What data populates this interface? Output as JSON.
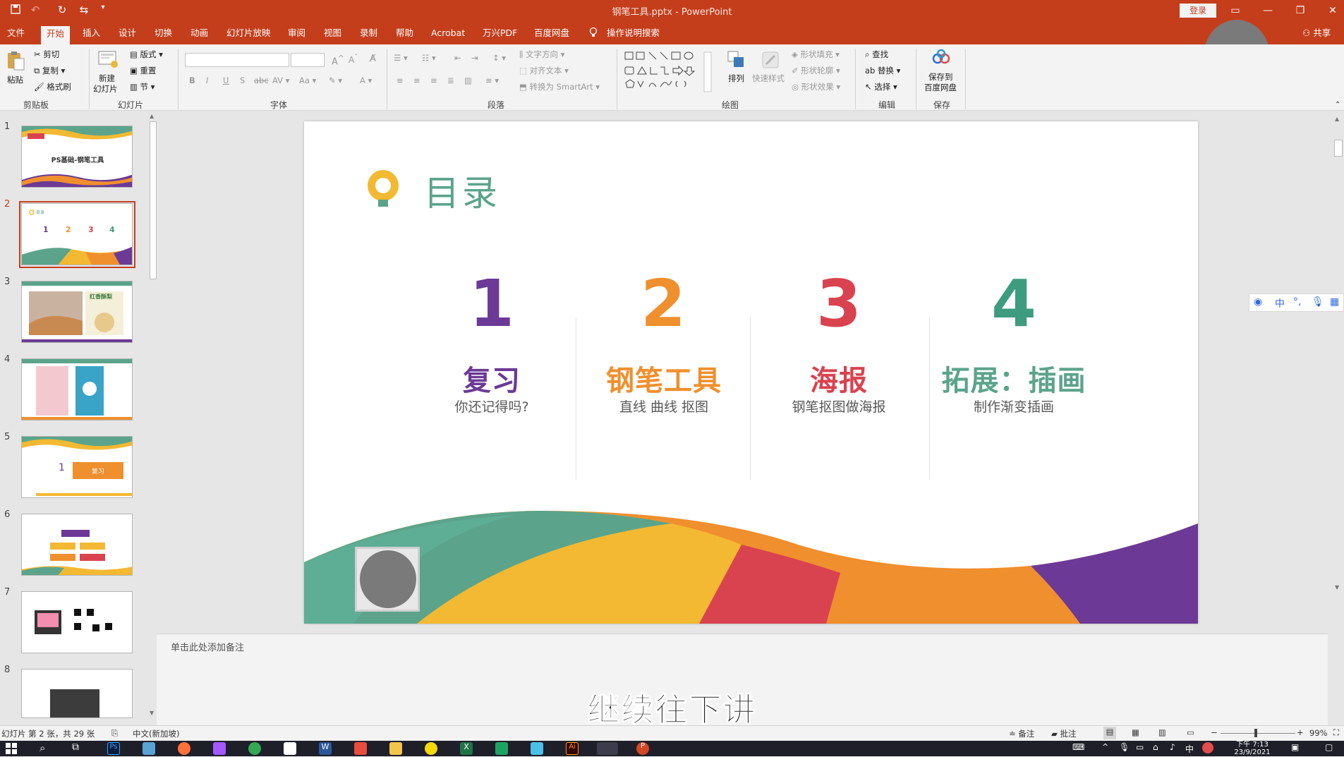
{
  "titlebar": {
    "title": "钢笔工具.pptx  -  PowerPoint",
    "login": "登录",
    "share": "共享",
    "tell_me": "操作说明搜索"
  },
  "tabs": [
    "文件",
    "开始",
    "插入",
    "设计",
    "切换",
    "动画",
    "幻灯片放映",
    "审阅",
    "视图",
    "录制",
    "帮助",
    "Acrobat",
    "万兴PDF",
    "百度网盘"
  ],
  "ribbon": {
    "clipboard": {
      "label": "剪贴板",
      "paste": "粘贴",
      "cut": "剪切",
      "copy": "复制",
      "format_painter": "格式刷"
    },
    "slides": {
      "label": "幻灯片",
      "new_slide_1": "新建",
      "new_slide_2": "幻灯片",
      "layout": "版式",
      "reset": "重置",
      "section": "节"
    },
    "font": {
      "label": "字体"
    },
    "paragraph": {
      "label": "段落",
      "text_direction": "文字方向",
      "align_text": "对齐文本",
      "smartart": "转换为 SmartArt"
    },
    "drawing": {
      "label": "绘图",
      "arrange": "排列",
      "quick_styles": "快速样式",
      "shape_fill": "形状填充",
      "shape_outline": "形状轮廓",
      "shape_effects": "形状效果"
    },
    "editing": {
      "label": "编辑",
      "find": "查找",
      "replace": "替换",
      "select": "选择"
    },
    "save": {
      "label": "保存",
      "save_to_1": "保存到",
      "save_to_2": "百度网盘"
    }
  },
  "thumbnails": [
    "1",
    "2",
    "3",
    "4",
    "5",
    "6",
    "7",
    "8"
  ],
  "thumb_text": {
    "t1_title": "PS基础-钢笔工具",
    "t3_title": "红香酥梨",
    "t5_label": "复习",
    "t5_num": "1"
  },
  "slide": {
    "heading": "目录",
    "items": [
      {
        "num": "1",
        "title": "复习",
        "desc": "你还记得吗?"
      },
      {
        "num": "2",
        "title": "钢笔工具",
        "desc": "直线 曲线  抠图"
      },
      {
        "num": "3",
        "title": "海报",
        "desc": "钢笔抠图做海报"
      },
      {
        "num": "4",
        "title": "拓展：插画",
        "desc": "制作渐变插画"
      }
    ]
  },
  "notes_placeholder": "单击此处添加备注",
  "subtitle": "继续往下讲",
  "statusbar": {
    "slide_info": "幻灯片 第 2 张，共 29 张",
    "language": "中文(新加坡)",
    "notes": "备注",
    "comments": "批注",
    "zoom": "99%"
  },
  "taskbar": {
    "time": "下午 7:13",
    "date": "23/9/2021",
    "ime": "中"
  },
  "colors": {
    "accent": "#c43e1c",
    "num1": "#6c3a96",
    "num2": "#f08f2e",
    "num3": "#d9434f",
    "num4": "#3d9c7d",
    "heading": "#5ba48b",
    "head1": "#6c3a96",
    "head2": "#f08f2e",
    "head3": "#d9434f",
    "head4": "#5ba48b"
  }
}
